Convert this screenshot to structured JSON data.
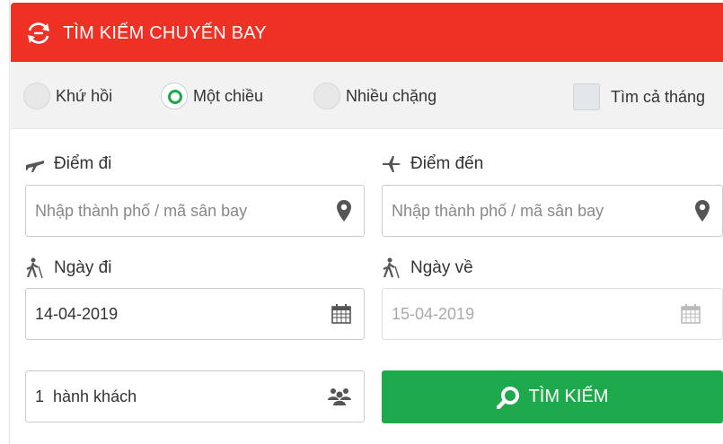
{
  "header": {
    "title": "TÌM KIẾM CHUYẾN BAY",
    "icon": "round-trip-arrows-icon"
  },
  "trip_type": {
    "options": [
      {
        "label": "Khứ hồi",
        "selected": false
      },
      {
        "label": "Một chiều",
        "selected": true
      },
      {
        "label": "Nhiều chặng",
        "selected": false
      }
    ],
    "whole_month_label": "Tìm cả tháng",
    "whole_month_checked": false
  },
  "origin": {
    "label": "Điểm đi",
    "placeholder": "Nhập thành phố / mã sân bay",
    "value": ""
  },
  "destination": {
    "label": "Điểm đến",
    "placeholder": "Nhập thành phố / mã sân bay",
    "value": ""
  },
  "depart": {
    "label": "Ngày đi",
    "value": "14-04-2019"
  },
  "return": {
    "label": "Ngày về",
    "value": "15-04-2019",
    "disabled": true
  },
  "passengers": {
    "value": "1  hành khách"
  },
  "search_button": {
    "label": "TÌM KIẾM"
  },
  "colors": {
    "header": "#ee3124",
    "accent_green": "#1ea94d",
    "icon_gray": "#555555"
  }
}
